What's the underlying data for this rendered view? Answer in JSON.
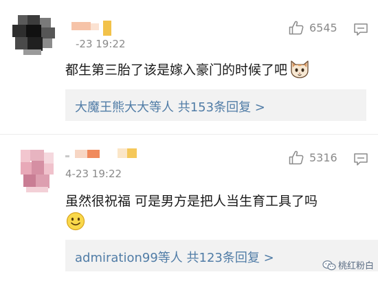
{
  "comments": [
    {
      "time": "-23 19:22",
      "text": "都生第三胎了该是嫁入豪门的时候了吧",
      "emoji_icon": "cat-face-icon",
      "likes": "6545",
      "reply_summary": "大魔王熊大大等人  共153条回复 >"
    },
    {
      "time": "4-23 19:22",
      "text": "虽然很祝福 可是男方是把人当生育工具了吗",
      "emoji_icon": "smiley-face-icon",
      "likes": "5316",
      "reply_summary": "admiration99等人  共123条回复 >"
    }
  ],
  "watermark": {
    "icon": "wechat-icon",
    "text": "桃红粉白"
  }
}
